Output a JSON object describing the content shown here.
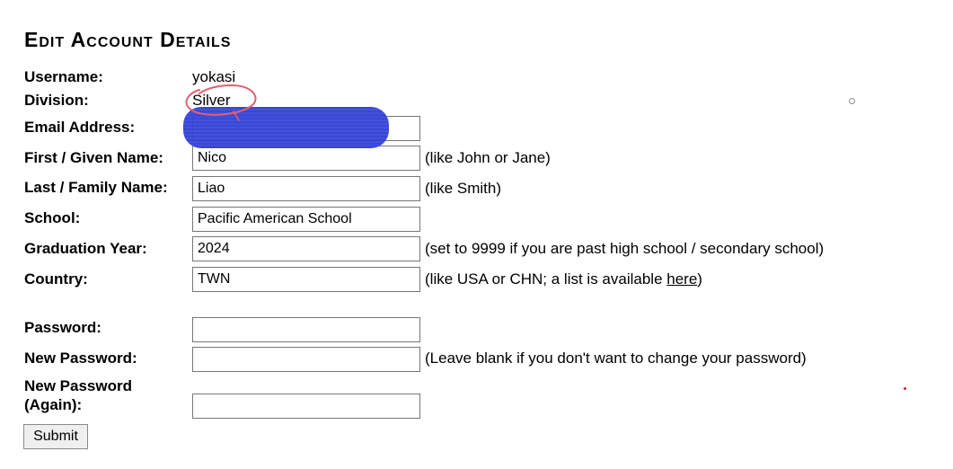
{
  "title": "Edit Account Details",
  "username": {
    "label": "Username:",
    "value": "yokasi"
  },
  "division": {
    "label": "Division:",
    "value": "Silver"
  },
  "email": {
    "label": "Email Address:",
    "value": ""
  },
  "first_name": {
    "label": "First / Given Name:",
    "value": "Nico",
    "hint": "(like John or Jane)"
  },
  "last_name": {
    "label": "Last / Family Name:",
    "value": "Liao",
    "hint": "(like Smith)"
  },
  "school": {
    "label": "School:",
    "value": "Pacific American School"
  },
  "grad_year": {
    "label": "Graduation Year:",
    "value": "2024",
    "hint": "(set to 9999 if you are past high school / secondary school)"
  },
  "country": {
    "label": "Country:",
    "value": "TWN",
    "hint_before": "(like USA or CHN; a list is available ",
    "hint_link": "here",
    "hint_after": ")"
  },
  "password": {
    "label": "Password:",
    "value": ""
  },
  "new_password": {
    "label": "New Password:",
    "value": "",
    "hint": "(Leave blank if you don't want to change your password)"
  },
  "new_password_again": {
    "label_line1": "New Password",
    "label_line2": "(Again):",
    "value": ""
  },
  "submit_label": "Submit",
  "colors": {
    "redaction": "#2f3ed0",
    "annotation": "#e06070"
  }
}
